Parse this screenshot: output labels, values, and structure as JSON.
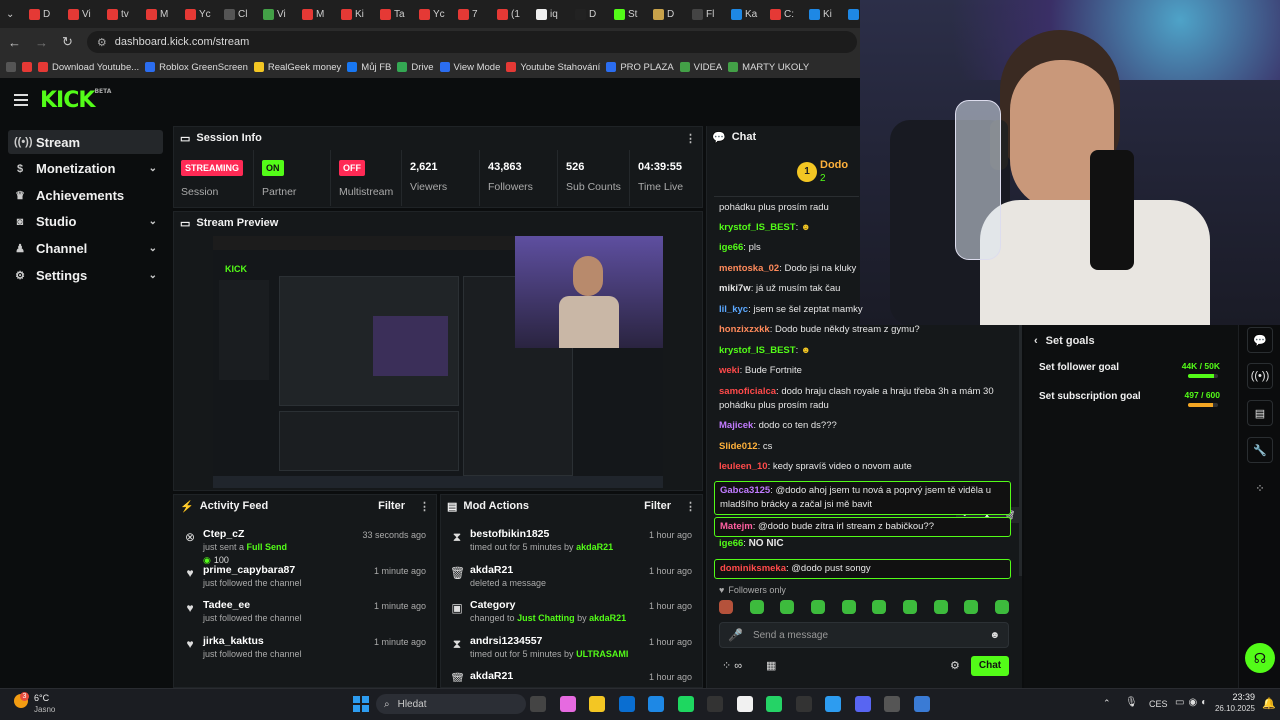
{
  "browser": {
    "tabs": [
      "D",
      "Vi",
      "tv",
      "M",
      "Yc",
      "Cl",
      "Vi",
      "M",
      "Ki",
      "Ta",
      "Yc",
      "7",
      "(1",
      "iq",
      "D",
      "St",
      "D",
      "Fl",
      "Ka",
      "C:",
      "Ki",
      "Bi"
    ],
    "url": "dashboard.kick.com/stream",
    "bookmarks": [
      "Download Youtube...",
      "Roblox GreenScreen",
      "RealGeek money",
      "Můj FB",
      "Drive",
      "View Mode",
      "Youtube Stahování",
      "PRO PLAZA",
      "VIDEA",
      "MARTY UKOLY"
    ]
  },
  "logo": {
    "text": "KICK",
    "beta": "BETA"
  },
  "sidebar": {
    "items": [
      {
        "label": "Stream",
        "icon": "broadcast-icon"
      },
      {
        "label": "Monetization",
        "icon": "dollar-icon"
      },
      {
        "label": "Achievements",
        "icon": "trophy-icon"
      },
      {
        "label": "Studio",
        "icon": "camera-icon"
      },
      {
        "label": "Channel",
        "icon": "person-icon"
      },
      {
        "label": "Settings",
        "icon": "gear-icon"
      }
    ]
  },
  "session": {
    "title": "Session Info",
    "stats": [
      {
        "badge": "STREAMING",
        "label": "Session"
      },
      {
        "badge": "ON",
        "label": "Partner Income"
      },
      {
        "badge": "OFF",
        "label": "Multistream"
      },
      {
        "value": "2,621",
        "label": "Viewers"
      },
      {
        "value": "43,863",
        "label": "Followers"
      },
      {
        "value": "526",
        "label": "Sub Counts"
      },
      {
        "value": "04:39:55",
        "label": "Time Live"
      }
    ]
  },
  "preview": {
    "title": "Stream Preview"
  },
  "activity": {
    "title": "Activity Feed",
    "filter": "Filter",
    "rows": [
      {
        "name": "Ctep_cZ",
        "text": "just sent a",
        "highlight": "Full Send",
        "amount": "100",
        "time": "33 seconds ago"
      },
      {
        "name": "prime_capybara87",
        "text": "just followed the channel",
        "time": "1 minute ago"
      },
      {
        "name": "Tadee_ee",
        "text": "just followed the channel",
        "time": "1 minute ago"
      },
      {
        "name": "jirka_kaktus",
        "text": "just followed the channel",
        "time": "1 minute ago"
      }
    ]
  },
  "mod": {
    "title": "Mod Actions",
    "filter": "Filter",
    "rows": [
      {
        "name": "bestofbikin1825",
        "text": "timed out for 5 minutes by",
        "by": "akdaR21",
        "time": "1 hour ago"
      },
      {
        "name": "akdaR21",
        "text": "deleted a message",
        "by": "",
        "time": "1 hour ago"
      },
      {
        "name": "Category",
        "text": "changed to",
        "by": "Just Chatting",
        "by2": "akdaR21",
        "time": "1 hour ago"
      },
      {
        "name": "andrsi1234557",
        "text": "timed out for 5 minutes by",
        "by": "ULTRASAMI",
        "time": "1 hour ago"
      },
      {
        "name": "akdaR21",
        "text": "",
        "by": "",
        "time": "1 hour ago"
      }
    ]
  },
  "chat": {
    "title": "Chat",
    "pinned_user": "Dodo",
    "pinned_count": "2",
    "messages": [
      {
        "user": "",
        "text": "pohádku plus prosím radu",
        "color": "#e6e6e6"
      },
      {
        "user": "krystof_IS_BEST",
        "text": "",
        "color": "#53fc18"
      },
      {
        "user": "ige66",
        "text": "pls",
        "color": "#53fc18"
      },
      {
        "user": "mentoska_02",
        "text": "Dodo jsi na kluky",
        "color": "#ff8a5b"
      },
      {
        "user": "miki7w",
        "text": "já už musím tak čau",
        "color": "#e6e6e6"
      },
      {
        "user": "lil_kyc",
        "text": "jsem se šel zeptat mamky",
        "color": "#5ba8ff"
      },
      {
        "user": "honzixzxkk",
        "text": "Dodo bude někdy stream z gymu?",
        "color": "#ff8a5b"
      },
      {
        "user": "krystof_IS_BEST",
        "text": "",
        "color": "#53fc18"
      },
      {
        "user": "weki",
        "text": "Bude Fortnite",
        "color": "#ff4a4a"
      },
      {
        "user": "samoficialca",
        "text": "dodo hraju clash royale a hraju třeba 3h a mám 30 pohádku plus prosím radu",
        "color": "#ff4a4a"
      },
      {
        "user": "Majicek",
        "text": "dodo co ten ds???",
        "color": "#c27bff"
      },
      {
        "user": "Slide012",
        "text": "cs",
        "color": "#ffb13b"
      },
      {
        "user": "Ieuleen_10",
        "text": "kedy spravíš video o novom aute",
        "color": "#ff4a4a"
      },
      {
        "user": "Gabca3125",
        "text": "@dodo ahoj jsem tu nová a poprvý jsem tě viděla u mladšího brácky a začal jsi mě bavit",
        "color": "#c27bff"
      },
      {
        "user": "Matejm",
        "text": "@dodo bude zítra irl stream z babičkou??",
        "color": "#ff5fa0"
      },
      {
        "user": "ige66",
        "text": "NO NIC",
        "color": "#53fc18"
      },
      {
        "user": "dominiksmeka",
        "text": "@dodo pust songy",
        "color": "#ff4a4a"
      }
    ],
    "followers_only": "Followers only",
    "input_placeholder": "Send a message",
    "send_label": "Chat"
  },
  "goals": {
    "title": "Set goals",
    "items": [
      {
        "label": "Set follower goal",
        "value": "44K / 50K",
        "progress": 0.88
      },
      {
        "label": "Set subscription goal",
        "value": "497 / 600",
        "progress": 0.83
      }
    ]
  },
  "taskbar": {
    "weather_temp": "6°C",
    "weather_text": "Jasno",
    "search": "Hledat",
    "lang": "CES",
    "time": "23:39",
    "date": "26.10.2025",
    "notif_badge": "3"
  },
  "colors": {
    "accent": "#53fc18",
    "streaming": "#ff2a55",
    "off": "#ff2a55",
    "panel": "#15181a"
  }
}
